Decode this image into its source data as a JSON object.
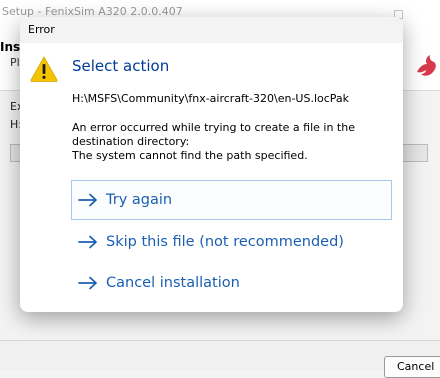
{
  "background_window": {
    "title": "Setup - FenixSim A320 2.0.0.407",
    "header_title": "Insta",
    "header_subtitle": "Pl",
    "body_line1": "Ex",
    "body_line2": "H:",
    "cancel_label": "Cancel"
  },
  "dialog": {
    "title": "Error",
    "heading": "Select action",
    "path": "H:\\MSFS\\Community\\fnx-aircraft-320\\en-US.locPak",
    "message_lines": [
      "An error occurred while trying to create a file in the",
      "destination directory:",
      "The system cannot find the path specified."
    ],
    "commands": [
      {
        "label": "Try again",
        "focused": true
      },
      {
        "label": "Skip this file (not recommended)",
        "focused": false
      },
      {
        "label": "Cancel installation",
        "focused": false
      }
    ]
  },
  "colors": {
    "accent": "#1a5fb4",
    "heading": "#003b99",
    "warning": "#f2c500",
    "brand_logo": "#d63a4a"
  },
  "icons": {
    "warning": "warning-icon",
    "arrow": "arrow-right-icon",
    "logo": "fenix-logo-icon"
  }
}
